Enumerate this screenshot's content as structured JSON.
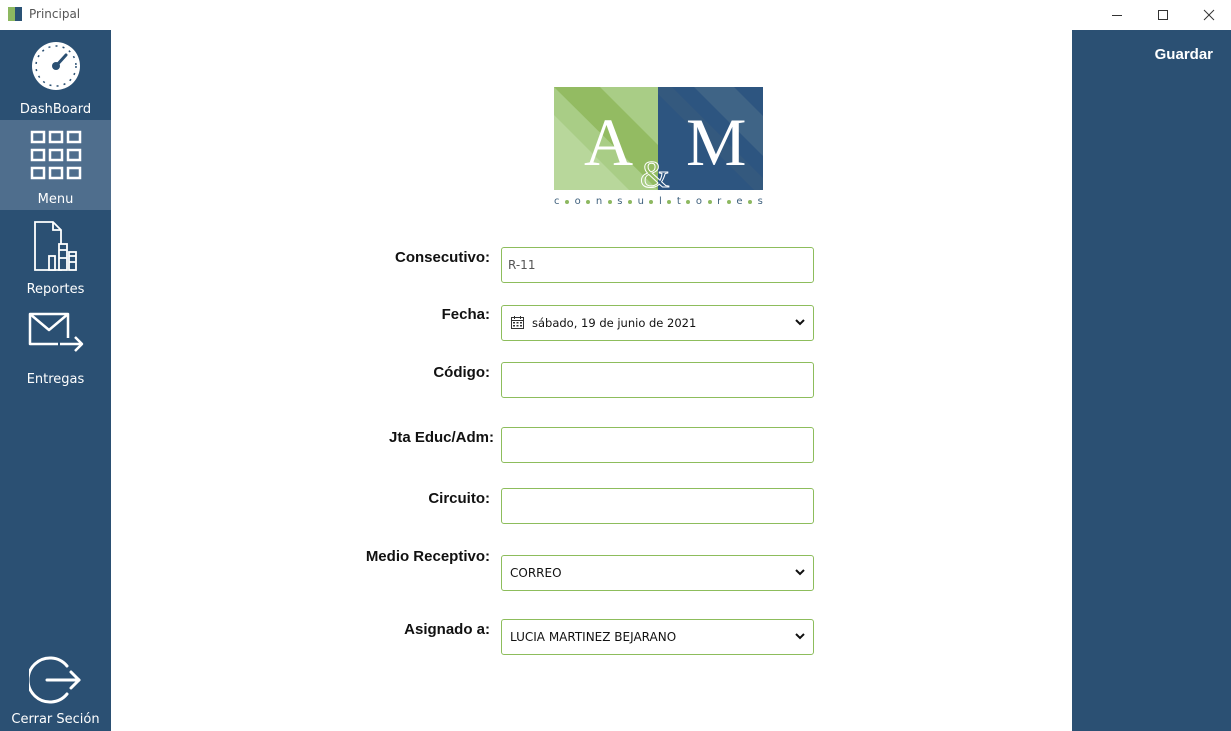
{
  "window": {
    "title": "Principal"
  },
  "sidebar": {
    "items": [
      {
        "label": "DashBoard",
        "icon": "dashboard-gauge-icon",
        "active": false
      },
      {
        "label": "Menu",
        "icon": "grid-menu-icon",
        "active": true
      },
      {
        "label": "Reportes",
        "icon": "report-chart-icon",
        "active": false
      },
      {
        "label": "Entregas",
        "icon": "mail-send-icon",
        "active": false
      }
    ],
    "logout_label": "Cerrar Seción"
  },
  "actions": {
    "save_label": "Guardar"
  },
  "logo": {
    "letters": "A&M",
    "tagline": "consultores"
  },
  "form": {
    "consecutivo": {
      "label": "Consecutivo:",
      "value": "R-11"
    },
    "fecha": {
      "label": "Fecha:",
      "value": "sábado, 19 de junio de 2021"
    },
    "codigo": {
      "label": "Código:",
      "value": ""
    },
    "junta": {
      "label": "Jta Educ/Adm:",
      "value": ""
    },
    "circuito": {
      "label": "Circuito:",
      "value": ""
    },
    "medio": {
      "label": "Medio Receptivo:",
      "value": "CORREO"
    },
    "asignado": {
      "label": "Asignado a:",
      "value": "LUCIA MARTINEZ BEJARANO"
    }
  },
  "colors": {
    "sidebar": "#2b5073",
    "sidebar_active": "#4f6e8d",
    "field_border": "#8dbd5c",
    "brand_green": "#8db860",
    "brand_blue": "#2a5275"
  }
}
